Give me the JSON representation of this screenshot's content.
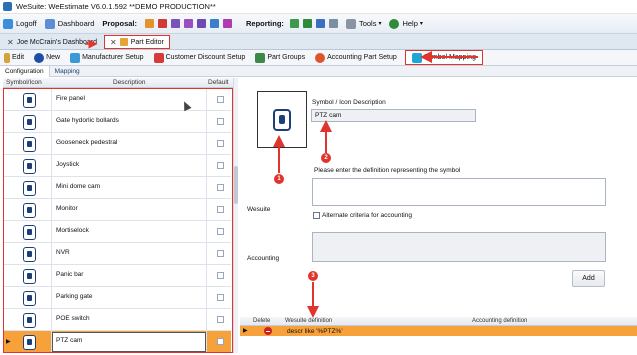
{
  "window": {
    "title": "WeSuite: WeEstimate V6.0.1.592 **DEMO PRODUCTION**"
  },
  "menubar": {
    "logoff": "Logoff",
    "dashboard": "Dashboard",
    "proposal": "Proposal:",
    "reporting": "Reporting:",
    "tools": "Tools",
    "help": "Help"
  },
  "doctabs": [
    {
      "label": "Joe McCrain's Dashboard"
    },
    {
      "label": "Part Editor"
    }
  ],
  "toolbar": {
    "edit": "Edit",
    "new": "New",
    "manufacturer_setup": "Manufacturer Setup",
    "customer_discount_setup": "Customer Discount Setup",
    "part_groups": "Part Groups",
    "accounting_part_setup": "Accounting Part Setup",
    "symbol_mapping": "Symbol Mapping"
  },
  "subtabs": {
    "configuration": "Configuration",
    "mapping": "Mapping"
  },
  "grid": {
    "headers": {
      "symbol": "Symbol/Icon",
      "description": "Description",
      "default": "Default"
    },
    "rows": [
      {
        "description": "Fire panel"
      },
      {
        "description": "Gate hydorlic bollards"
      },
      {
        "description": "Gooseneck pedestral"
      },
      {
        "description": "Joystick"
      },
      {
        "description": "Mini dome cam"
      },
      {
        "description": "Monitor"
      },
      {
        "description": "Mortiselock"
      },
      {
        "description": "NVR"
      },
      {
        "description": "Panic bar"
      },
      {
        "description": "Parking gate"
      },
      {
        "description": "POE switch"
      },
      {
        "description": "PTZ cam"
      }
    ]
  },
  "details": {
    "symbol_desc_label": "Symbol / Icon Description",
    "symbol_desc_value": "PTZ cam",
    "definition_prompt": "Please enter the definition representing the symbol",
    "wesuite_label": "Wesuite",
    "alternate_label": "Alternate criteria for accounting",
    "accounting_label": "Accounting",
    "add_button": "Add"
  },
  "mapping": {
    "headers": {
      "delete": "Delete",
      "wesuite_def": "Wesuite definition",
      "accounting_def": "Accounting definition"
    },
    "rows": [
      {
        "wesuite_def": "descr like '%PTZ%'",
        "accounting_def": ""
      }
    ]
  },
  "annotations": {
    "badge1": "1",
    "badge2": "2",
    "badge3": "3"
  },
  "colors": {
    "highlight": "#e0342c",
    "selected_row": "#f7a13a",
    "icon_blue": "#1c3f7a"
  }
}
